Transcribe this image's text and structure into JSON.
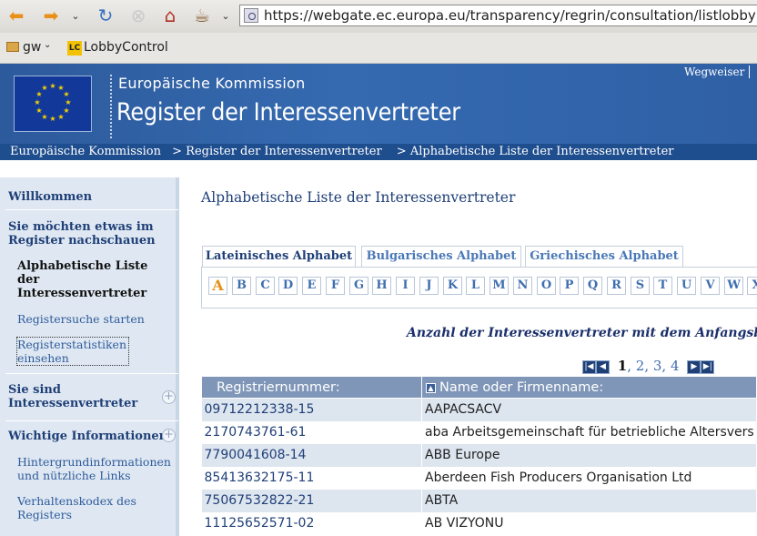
{
  "browser": {
    "url": "https://webgate.ec.europa.eu/transparency/regrin/consultation/listlobbyist",
    "bookmarks": [
      "gw",
      "LobbyControl"
    ]
  },
  "header": {
    "org": "Europäische Kommission",
    "title": "Register der Interessenvertreter",
    "wegweiser": "Wegweiser"
  },
  "breadcrumb": [
    "Europäische Kommission",
    "> Register der Interessenvertreter",
    "> Alphabetische Liste der Interessenvertreter"
  ],
  "sidebar": {
    "willkommen": "Willkommen",
    "section1": "Sie möchten etwas im Register nachschauen",
    "current": "Alphabetische Liste der Interessenvertreter",
    "link1": "Registersuche starten",
    "link2": "Registerstatistiken einsehen",
    "section2": "Sie sind Interessenvertreter",
    "section3": "Wichtige Informationen",
    "link3": "Hintergrundinformationen und nützliche Links",
    "link4": "Verhaltenskodex des Registers"
  },
  "main": {
    "title": "Alphabetische Liste der Interessenvertreter",
    "tabs": [
      "Lateinisches Alphabet",
      "Bulgarisches Alphabet",
      "Griechisches Alphabet"
    ],
    "letters": [
      "A",
      "B",
      "C",
      "D",
      "E",
      "F",
      "G",
      "H",
      "I",
      "J",
      "K",
      "L",
      "M",
      "N",
      "O",
      "P",
      "Q",
      "R",
      "S",
      "T",
      "U",
      "V",
      "W",
      "X"
    ],
    "selected_letter": "A",
    "count_label": "Anzahl der Interessenvertreter mit dem Anfangsb",
    "pager": {
      "current": "1",
      "pages": [
        "2",
        "3",
        "4"
      ]
    },
    "columns": [
      "Registriernummer:",
      "Name oder Firmenname:"
    ],
    "rows": [
      [
        "09712212338-15",
        "AAPACSACV"
      ],
      [
        "2170743761-61",
        "aba Arbeitsgemeinschaft für betriebliche Altersvers"
      ],
      [
        "7790041608-14",
        "ABB Europe"
      ],
      [
        "85413632175-11",
        "Aberdeen Fish Producers Organisation Ltd"
      ],
      [
        "75067532822-21",
        "ABTA"
      ],
      [
        "11125652571-02",
        "AB VIZYONU"
      ]
    ]
  },
  "colors": {
    "banner": "#356ab0",
    "breadcrumb_bar": "#1f4e8f",
    "table_header": "#7f96b8",
    "link": "#3f6eaf",
    "selected_letter": "#e3911a"
  }
}
